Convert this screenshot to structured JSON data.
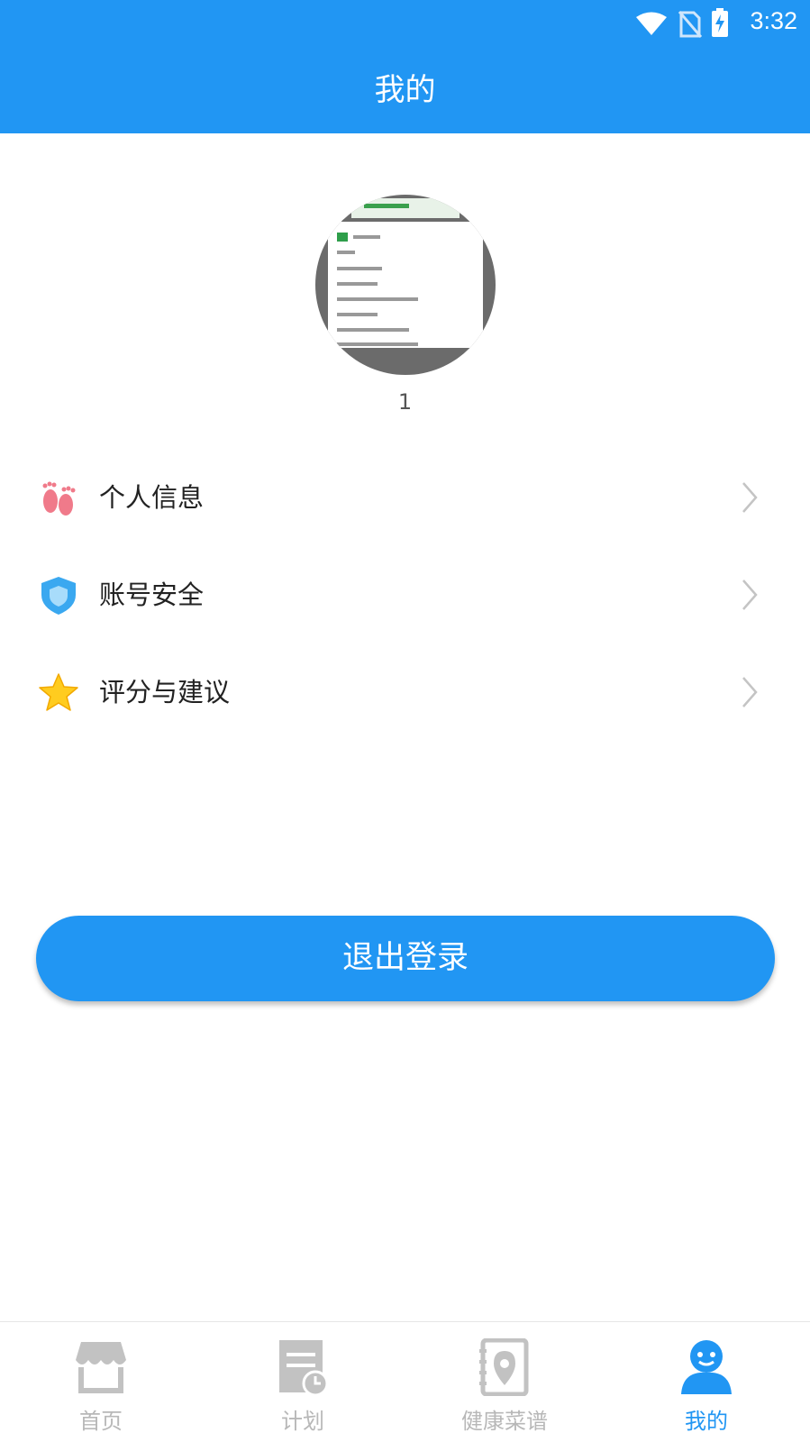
{
  "status_bar": {
    "time": "3:32"
  },
  "header": {
    "title": "我的"
  },
  "profile": {
    "username": "1"
  },
  "menu": [
    {
      "label": "个人信息",
      "icon": "footprints-icon"
    },
    {
      "label": "账号安全",
      "icon": "shield-icon"
    },
    {
      "label": "评分与建议",
      "icon": "star-icon"
    }
  ],
  "logout": {
    "label": "退出登录"
  },
  "tabs": [
    {
      "label": "首页",
      "icon": "store-icon",
      "active": false
    },
    {
      "label": "计划",
      "icon": "plan-clock-icon",
      "active": false
    },
    {
      "label": "健康菜谱",
      "icon": "recipe-book-icon",
      "active": false
    },
    {
      "label": "我的",
      "icon": "person-icon",
      "active": true
    }
  ],
  "colors": {
    "primary": "#2196F3",
    "inactive_tab": "#B8B8B8"
  }
}
